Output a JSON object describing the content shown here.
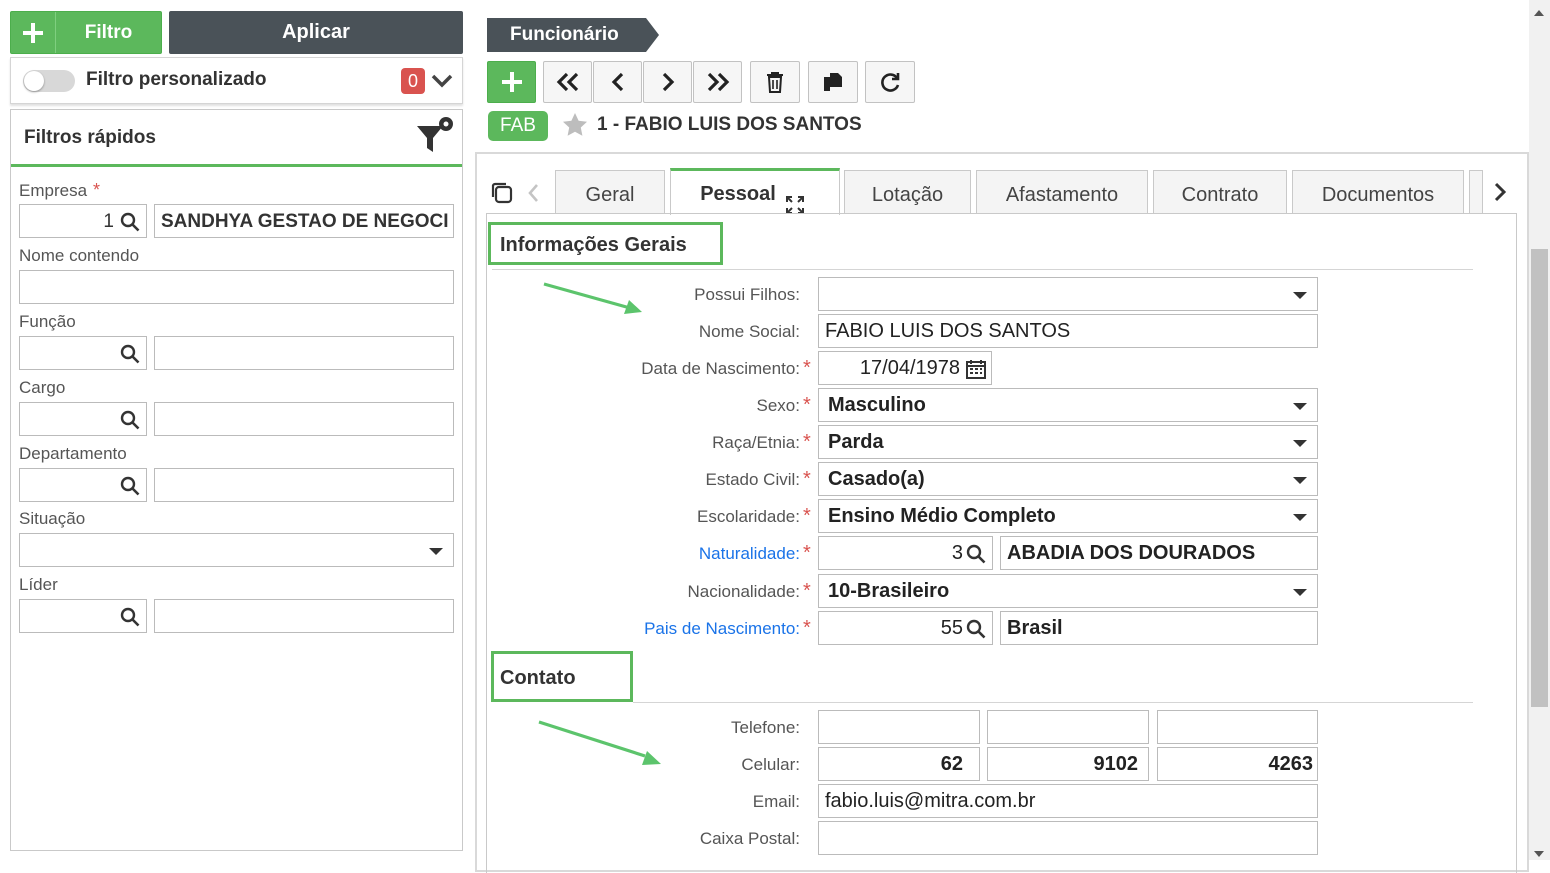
{
  "left": {
    "filter_button_label": "Filtro",
    "apply_button_label": "Aplicar",
    "custom_filter_label": "Filtro personalizado",
    "custom_filter_count": "0",
    "quick_filters_title": "Filtros rápidos",
    "fields": {
      "empresa_label": "Empresa",
      "empresa_code": "1",
      "empresa_name": "SANDHYA GESTAO DE NEGOCIOS",
      "nome_label": "Nome contendo",
      "funcao_label": "Função",
      "cargo_label": "Cargo",
      "departamento_label": "Departamento",
      "situacao_label": "Situação",
      "lider_label": "Líder"
    }
  },
  "breadcrumb": "Funcionário",
  "record": {
    "badge": "FAB",
    "title": "1 - FABIO LUIS DOS SANTOS"
  },
  "tabs": [
    "Geral",
    "Pessoal",
    "Lotação",
    "Afastamento",
    "Contrato",
    "Documentos"
  ],
  "active_tab": "Pessoal",
  "sections": {
    "general_title": "Informações Gerais",
    "contact_title": "Contato"
  },
  "form": {
    "filhos_label": "Possui Filhos:",
    "nome_social_label": "Nome Social:",
    "nome_social": "FABIO LUIS DOS SANTOS",
    "nascimento_label": "Data de Nascimento:",
    "nascimento": "17/04/1978",
    "sexo_label": "Sexo:",
    "sexo": "Masculino",
    "raca_label": "Raça/Etnia:",
    "raca": "Parda",
    "estado_civil_label": "Estado Civil:",
    "estado_civil": "Casado(a)",
    "escolaridade_label": "Escolaridade:",
    "escolaridade": "Ensino Médio Completo",
    "naturalidade_label": "Naturalidade:",
    "naturalidade_code": "3",
    "naturalidade_name": "ABADIA DOS DOURADOS",
    "nacionalidade_label": "Nacionalidade:",
    "nacionalidade": "10-Brasileiro",
    "pais_label": "Pais de Nascimento:",
    "pais_code": "55",
    "pais_name": "Brasil",
    "telefone_label": "Telefone:",
    "celular_label": "Celular:",
    "celular_ddd": "62",
    "celular_prefix": "9102",
    "celular_suffix": "4263",
    "email_label": "Email:",
    "email": "fabio.luis@mitra.com.br",
    "caixa_postal_label": "Caixa Postal:"
  },
  "colors": {
    "accent_green": "#5cb85c",
    "dark": "#4a5258",
    "required_red": "#d9534f",
    "link_blue": "#1a73e8"
  }
}
